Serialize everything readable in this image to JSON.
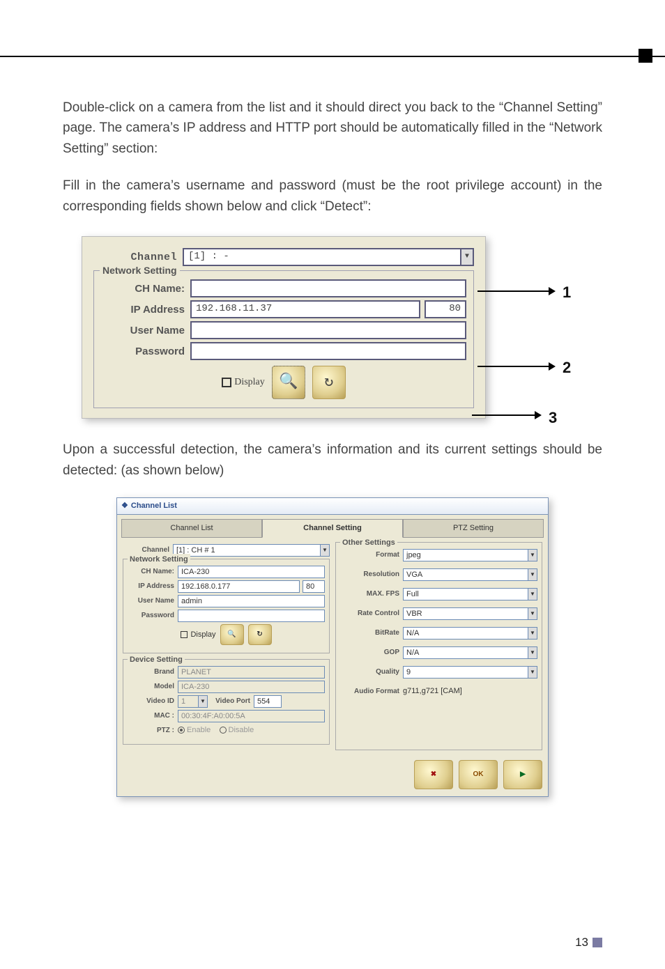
{
  "para1": "Double-click on a camera from the list and it should direct you back to the “Channel Setting” page. The camera’s IP address and HTTP port should be automatically filled in the “Network Setting” section:",
  "para2": "Fill in the camera’s username and password (must be the root privilege account) in the corresponding fields shown below and click “Detect”:",
  "para3": "Upon a successful detection, the camera’s information and its current settings should be detected: (as shown below)",
  "shot1": {
    "channel_label": "Channel",
    "channel_value": "[1] : -",
    "fieldset_legend": "Network Setting",
    "ch_name_label": "CH Name:",
    "ch_name_value": "",
    "ip_label": "IP Address",
    "ip_value": "192.168.11.37",
    "port_value": "80",
    "user_label": "User Name",
    "user_value": "",
    "pass_label": "Password",
    "pass_value": "",
    "display_label": "Display"
  },
  "callouts": {
    "n1": "1",
    "n2": "2",
    "n3": "3"
  },
  "shot2": {
    "title": "Channel List",
    "tabs": {
      "t1": "Channel List",
      "t2": "Channel Setting",
      "t3": "PTZ Setting"
    },
    "left": {
      "channel_label": "Channel",
      "channel_value": "[1] : CH # 1",
      "net_legend": "Network Setting",
      "chname_label": "CH Name:",
      "chname_value": "ICA-230",
      "ip_label": "IP Address",
      "ip_value": "192.168.0.177",
      "port_value": "80",
      "user_label": "User Name",
      "user_value": "admin",
      "pass_label": "Password",
      "pass_value": "",
      "display_label": "Display",
      "dev_legend": "Device Setting",
      "brand_label": "Brand",
      "brand_value": "PLANET",
      "model_label": "Model",
      "model_value": "ICA-230",
      "videoid_label": "Video ID",
      "videoid_value": "1",
      "videoport_label": "Video Port",
      "videoport_value": "554",
      "mac_label": "MAC :",
      "mac_value": "00:30:4F:A0:00:5A",
      "ptz_label": "PTZ :",
      "ptz_enable": "Enable",
      "ptz_disable": "Disable"
    },
    "right": {
      "legend": "Other Settings",
      "format_label": "Format",
      "format_value": "jpeg",
      "res_label": "Resolution",
      "res_value": "VGA",
      "fps_label": "MAX. FPS",
      "fps_value": "Full",
      "rc_label": "Rate Control",
      "rc_value": "VBR",
      "br_label": "BitRate",
      "br_value": "N/A",
      "gop_label": "GOP",
      "gop_value": "N/A",
      "q_label": "Quality",
      "q_value": "9",
      "af_label": "Audio Format",
      "af_value": "g711,g721 [CAM]"
    },
    "buttons": {
      "cancel_icon": "✖",
      "ok": "OK",
      "go_icon": "▶"
    }
  },
  "page_number": "13"
}
